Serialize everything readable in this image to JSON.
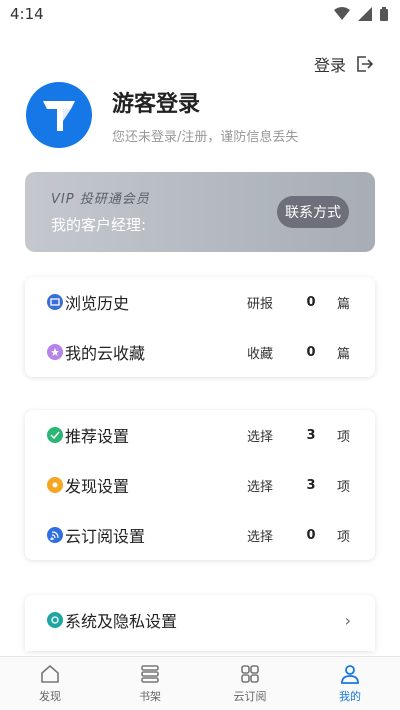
{
  "status_bar": {
    "time": "4:14"
  },
  "header": {
    "login_label": "登录"
  },
  "profile": {
    "name": "游客登录",
    "subtitle": "您还未登录/注册，谨防信息丢失"
  },
  "vip": {
    "title": "VIP 投研通会员",
    "manager_label": "我的客户经理:",
    "contact_button": "联系方式"
  },
  "group1": [
    {
      "label": "浏览历史",
      "kind": "研报",
      "count": "0",
      "unit": "篇",
      "icon": "history-icon",
      "color": "#3b6fd8"
    },
    {
      "label": "我的云收藏",
      "kind": "收藏",
      "count": "0",
      "unit": "篇",
      "icon": "star-icon",
      "color": "#b783e6"
    }
  ],
  "group2": [
    {
      "label": "推荐设置",
      "kind": "选择",
      "count": "3",
      "unit": "项",
      "icon": "recommend-icon",
      "color": "#2bb673"
    },
    {
      "label": "发现设置",
      "kind": "选择",
      "count": "3",
      "unit": "项",
      "icon": "discover-icon",
      "color": "#f5a623"
    },
    {
      "label": "云订阅设置",
      "kind": "选择",
      "count": "0",
      "unit": "项",
      "icon": "subscribe-icon",
      "color": "#2f6fe0"
    }
  ],
  "group3": {
    "label": "系统及隐私设置",
    "icon": "privacy-icon",
    "color": "#20a6a0"
  },
  "nav": [
    {
      "label": "发现",
      "icon": "home-icon",
      "active": false
    },
    {
      "label": "书架",
      "icon": "bookshelf-icon",
      "active": false
    },
    {
      "label": "云订阅",
      "icon": "grid-icon",
      "active": false
    },
    {
      "label": "我的",
      "icon": "user-icon",
      "active": true
    }
  ],
  "colors": {
    "accent": "#1677e6"
  }
}
